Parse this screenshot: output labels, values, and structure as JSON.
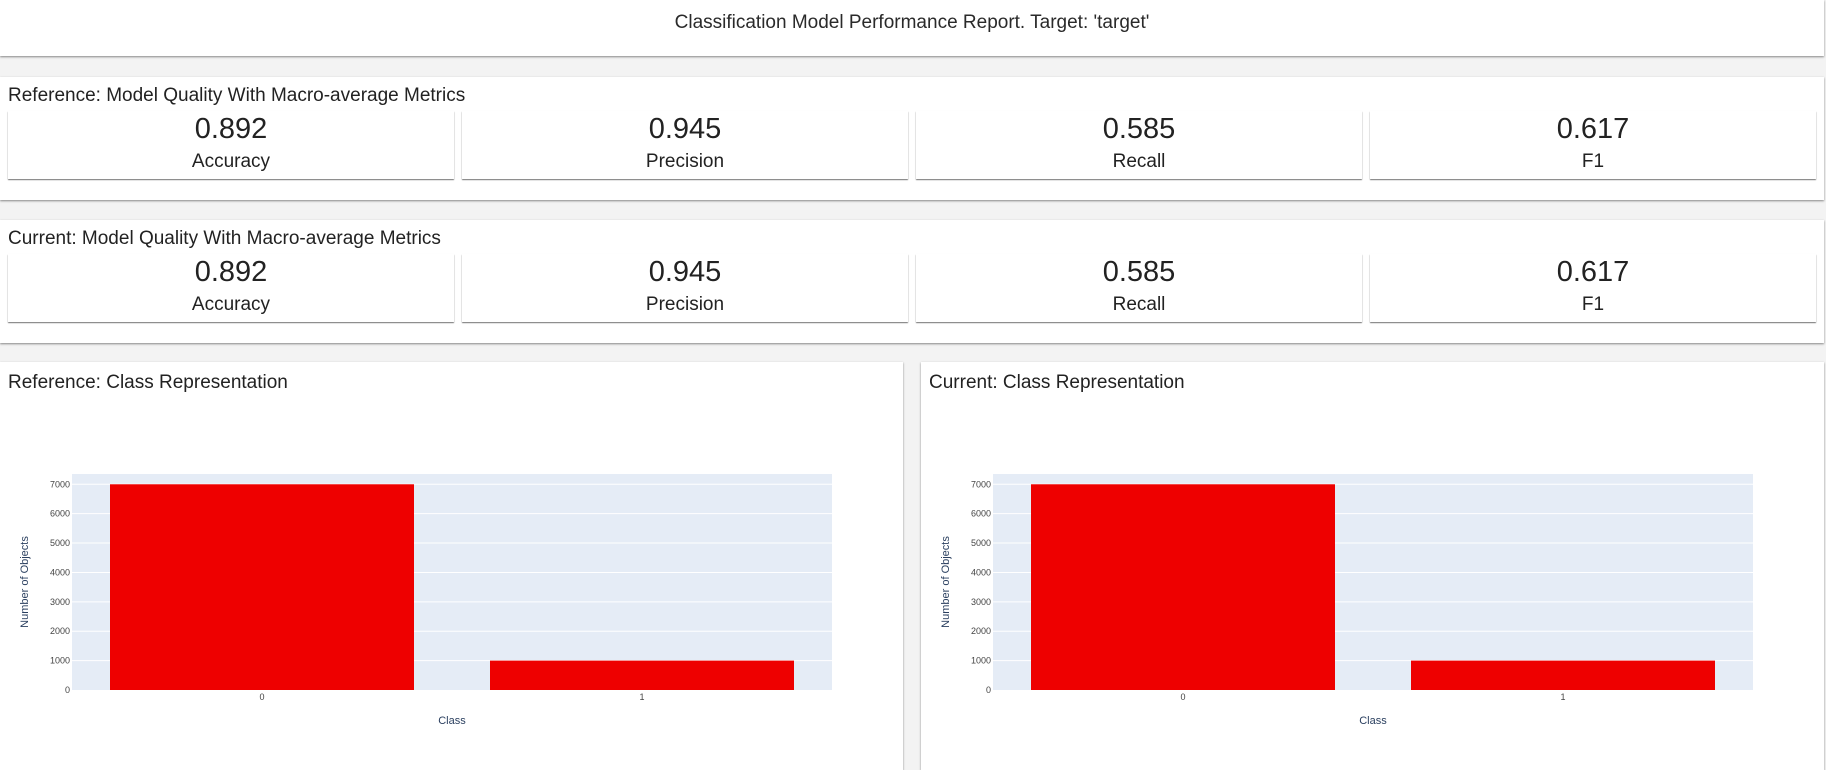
{
  "report": {
    "title": "Classification Model Performance Report. Target: 'target'"
  },
  "reference_metrics": {
    "heading": "Reference: Model Quality With Macro-average Metrics",
    "items": [
      {
        "value": "0.892",
        "label": "Accuracy"
      },
      {
        "value": "0.945",
        "label": "Precision"
      },
      {
        "value": "0.585",
        "label": "Recall"
      },
      {
        "value": "0.617",
        "label": "F1"
      }
    ]
  },
  "current_metrics": {
    "heading": "Current: Model Quality With Macro-average Metrics",
    "items": [
      {
        "value": "0.892",
        "label": "Accuracy"
      },
      {
        "value": "0.945",
        "label": "Precision"
      },
      {
        "value": "0.585",
        "label": "Recall"
      },
      {
        "value": "0.617",
        "label": "F1"
      }
    ]
  },
  "reference_chart": {
    "heading": "Reference: Class Representation"
  },
  "current_chart": {
    "heading": "Current: Class Representation"
  },
  "colors": {
    "bar": "#ee0000",
    "plot_bg": "#e5ecf6",
    "grid": "#ffffff"
  },
  "chart_data": [
    {
      "type": "bar",
      "title": "Reference: Class Representation",
      "categories": [
        "0",
        "1"
      ],
      "values": [
        7000,
        1000
      ],
      "xlabel": "Class",
      "ylabel": "Number of Objects",
      "ylim": [
        0,
        7350
      ],
      "yticks": [
        0,
        1000,
        2000,
        3000,
        4000,
        5000,
        6000,
        7000
      ],
      "grid": true
    },
    {
      "type": "bar",
      "title": "Current: Class Representation",
      "categories": [
        "0",
        "1"
      ],
      "values": [
        7000,
        1000
      ],
      "xlabel": "Class",
      "ylabel": "Number of Objects",
      "ylim": [
        0,
        7350
      ],
      "yticks": [
        0,
        1000,
        2000,
        3000,
        4000,
        5000,
        6000,
        7000
      ],
      "grid": true
    }
  ]
}
